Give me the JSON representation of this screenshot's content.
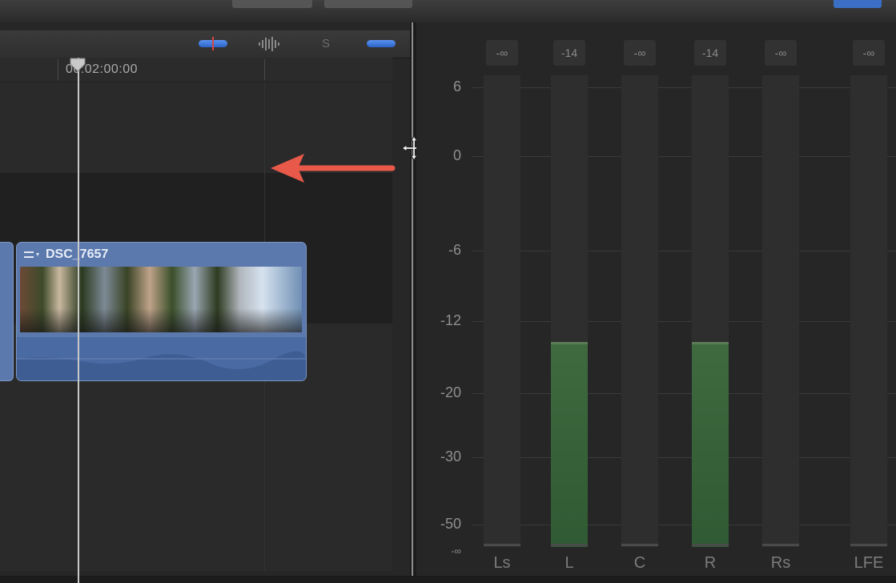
{
  "timeline": {
    "timecode": "00:02:00:00",
    "clip": {
      "title": "DSC_7657"
    },
    "toolbar": [
      "video-only-button",
      "audio-waveform-button",
      "solo-button",
      "skimming-button"
    ],
    "solo_glyph": "S"
  },
  "audio_meters": {
    "peaks": [
      "-∞",
      "-14",
      "-∞",
      "-14",
      "-∞",
      "-∞"
    ],
    "scale": [
      "6",
      "0",
      "-6",
      "-12",
      "-20",
      "-30",
      "-50",
      "-∞"
    ],
    "channels": [
      "Ls",
      "L",
      "C",
      "R",
      "Rs",
      "LFE"
    ],
    "levels_db": [
      null,
      -14,
      null,
      -14,
      null,
      null
    ],
    "meter_color": "#3f6a3f"
  },
  "annotation": {
    "arrow_color": "#e8594a"
  }
}
